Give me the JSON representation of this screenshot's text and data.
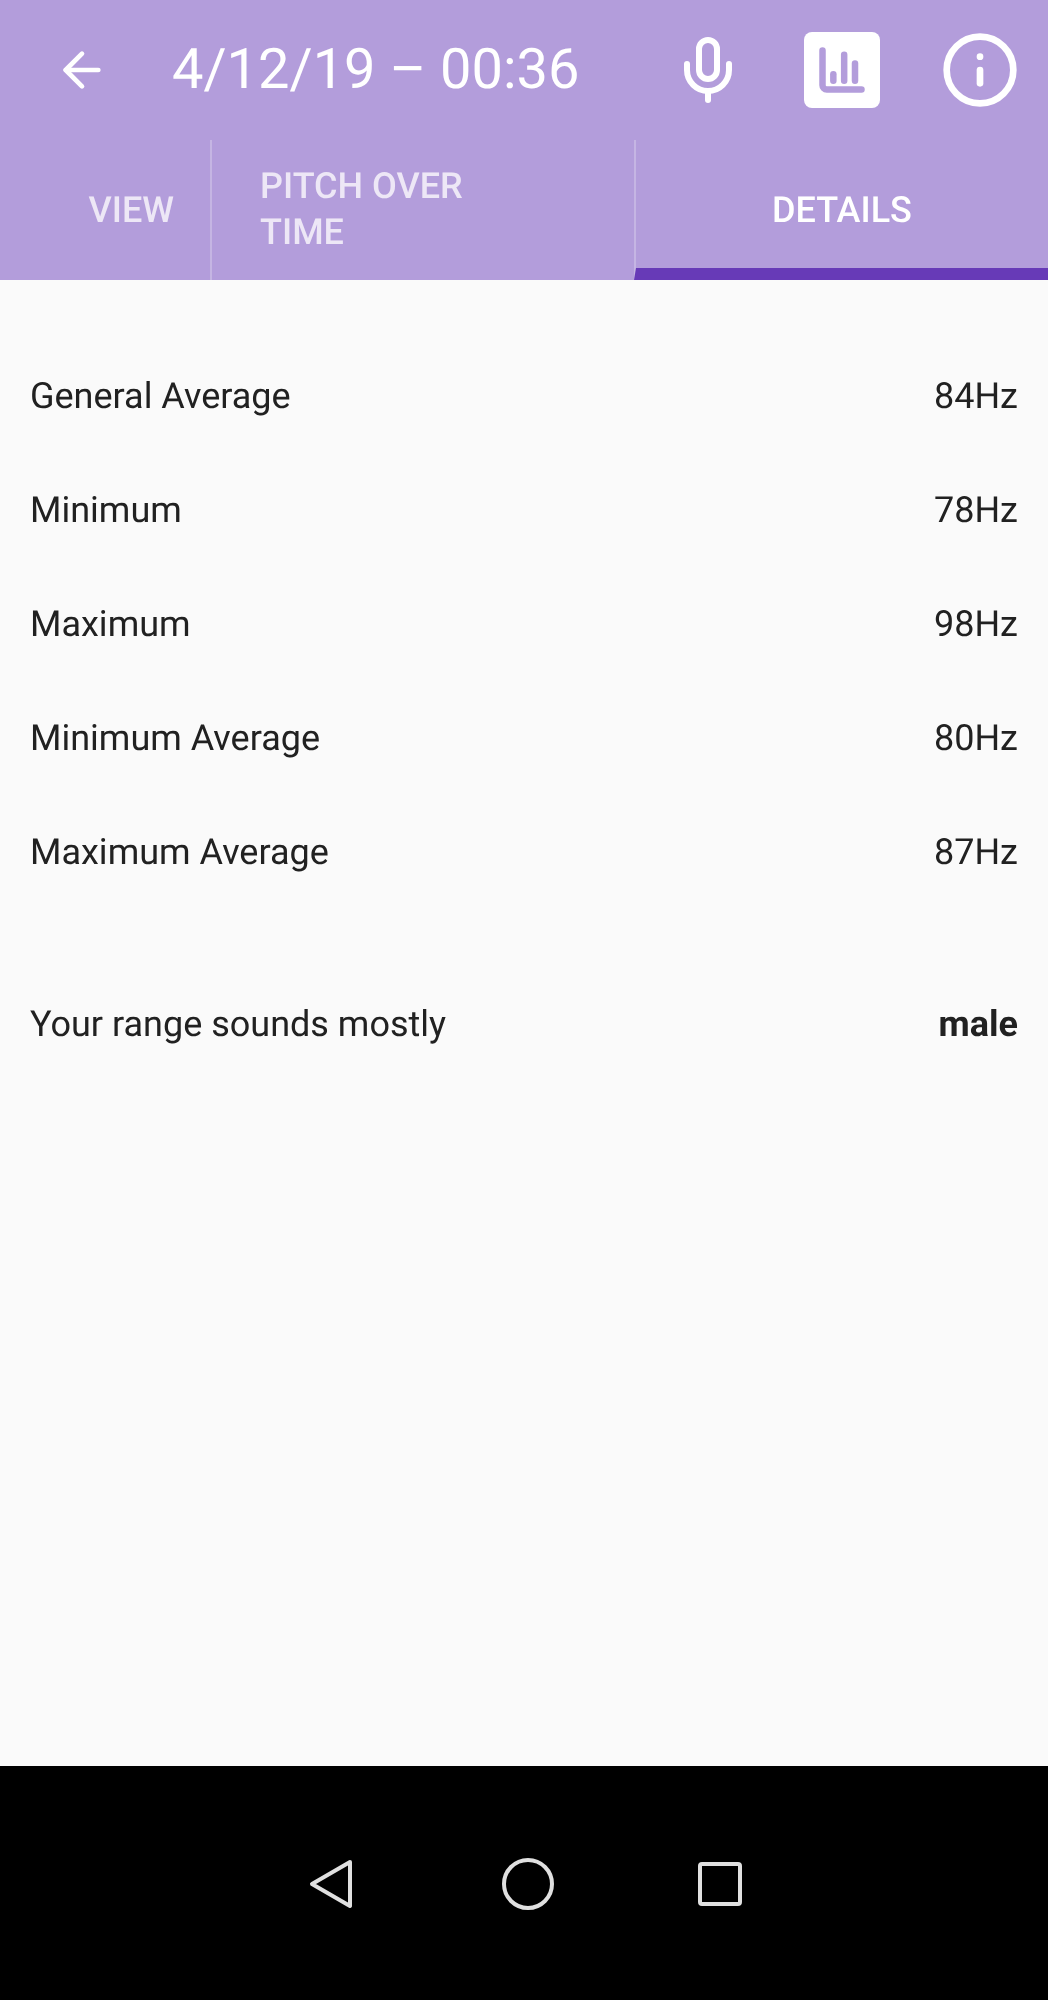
{
  "app_bar": {
    "title": "4/12/19 – 00:36"
  },
  "tabs": [
    {
      "label": "VIEW",
      "selected": false
    },
    {
      "label": "PITCH OVER TIME",
      "selected": false
    },
    {
      "label": "DETAILS",
      "selected": true
    }
  ],
  "stats": [
    {
      "label": "General Average",
      "value": "84Hz"
    },
    {
      "label": "Minimum",
      "value": "78Hz"
    },
    {
      "label": "Maximum",
      "value": "98Hz"
    },
    {
      "label": "Minimum Average",
      "value": "80Hz"
    },
    {
      "label": "Maximum Average",
      "value": "87Hz"
    }
  ],
  "range": {
    "label": "Your range sounds mostly",
    "value": "male"
  }
}
